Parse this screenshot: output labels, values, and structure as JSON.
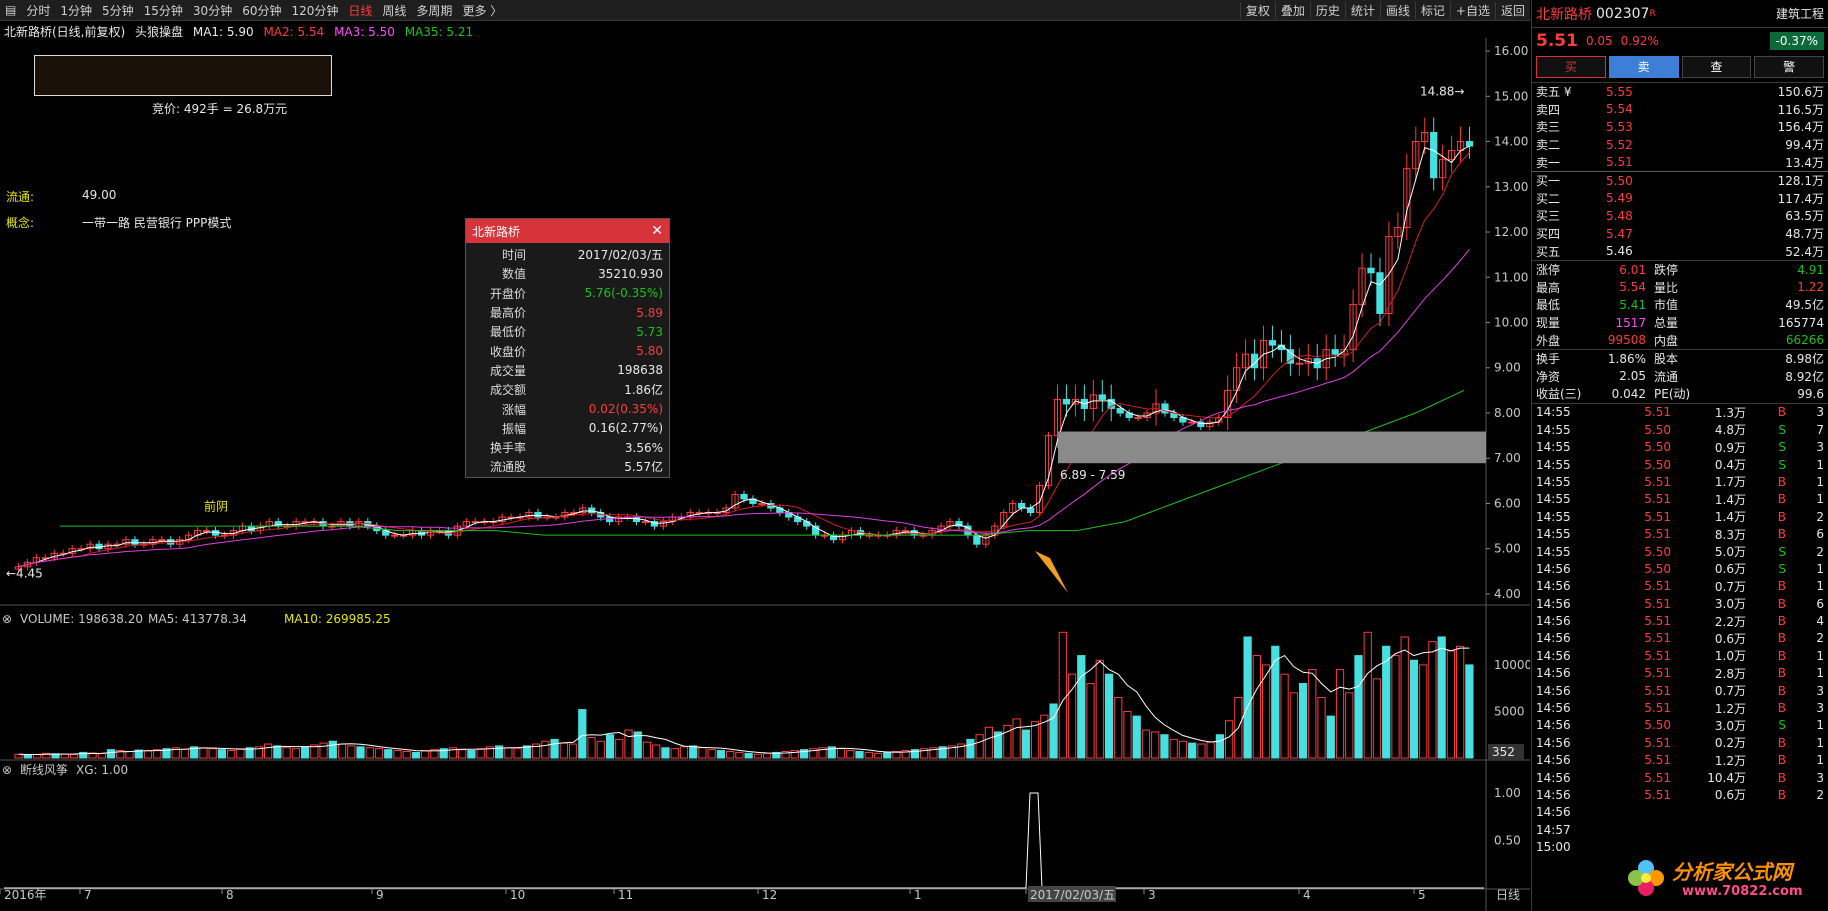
{
  "topbar": {
    "periods": [
      "分时",
      "1分钟",
      "5分钟",
      "15分钟",
      "30分钟",
      "60分钟",
      "120分钟",
      "日线",
      "周线",
      "多周期",
      "更多 〉"
    ],
    "active_index": 7,
    "tools": [
      "复权",
      "叠加",
      "历史",
      "统计",
      "画线",
      "标记",
      "+自选",
      "返回"
    ]
  },
  "legend": {
    "title": "北新路桥(日线,前复权)",
    "formula": "头狼操盘",
    "ma1": "MA1: 5.90",
    "ma2": "MA2: 5.54",
    "ma3": "MA3: 5.50",
    "ma35": "MA35: 5.21"
  },
  "overlay": {
    "auction": "竞价: 492手 = 26.8万元",
    "float_label": "流通:",
    "float_value": "49.00",
    "concept_label": "概念:",
    "concept_value": "一带一路 民营银行 PPP模式",
    "low_price": "←4.45",
    "high_price": "14.88→",
    "range_label": "6.89 - 7.59",
    "marker": "前阴"
  },
  "price_axis": [
    "16.00",
    "15.00",
    "14.00",
    "13.00",
    "12.00",
    "11.00",
    "10.00",
    "9.00",
    "8.00",
    "7.00",
    "6.00",
    "5.00",
    "4.00"
  ],
  "volume": {
    "label": "VOLUME: 198638.20",
    "ma5": "MA5: 413778.34",
    "ma10": "MA10: 269985.25",
    "axis": [
      "10000",
      "5000"
    ],
    "current": "352"
  },
  "indicator": {
    "label": "断线风筝",
    "xg": "XG: 1.00",
    "axis": [
      "1.00",
      "0.50"
    ]
  },
  "date_axis": [
    "2016年",
    "7",
    "8",
    "9",
    "10",
    "11",
    "12",
    "1",
    "2017/02/03/五",
    "3",
    "4",
    "5"
  ],
  "period_button": "日线",
  "tooltip": {
    "title": "北新路桥",
    "rows": [
      {
        "label": "时间",
        "value": "2017/02/03/五",
        "color": "#e8e8e8"
      },
      {
        "label": "数值",
        "value": "35210.930",
        "color": "#e8e8e8"
      },
      {
        "label": "开盘价",
        "value": "5.76(-0.35%)",
        "color": "#19c219"
      },
      {
        "label": "最高价",
        "value": "5.89",
        "color": "#ff3b3b"
      },
      {
        "label": "最低价",
        "value": "5.73",
        "color": "#19c219"
      },
      {
        "label": "收盘价",
        "value": "5.80",
        "color": "#ff3b3b"
      },
      {
        "label": "成交量",
        "value": "198638",
        "color": "#e8e8e8"
      },
      {
        "label": "成交额",
        "value": "1.86亿",
        "color": "#e8e8e8"
      },
      {
        "label": "涨幅",
        "value": "0.02(0.35%)",
        "color": "#ff3b3b"
      },
      {
        "label": "振幅",
        "value": "0.16(2.77%)",
        "color": "#e8e8e8"
      },
      {
        "label": "换手率",
        "value": "3.56%",
        "color": "#e8e8e8"
      },
      {
        "label": "流通股",
        "value": "5.57亿",
        "color": "#e8e8e8"
      }
    ]
  },
  "quote": {
    "name": "北新路桥",
    "code": "002307",
    "badge": "R",
    "sector": "建筑工程",
    "sector_change": "-0.37%",
    "price": "5.51",
    "change": "0.05",
    "change_pct": "0.92%",
    "buttons": [
      "买",
      "卖",
      "查",
      "警"
    ],
    "asks": [
      {
        "label": "卖五 ¥",
        "price": "5.55",
        "vol": "150.6万"
      },
      {
        "label": "卖四",
        "price": "5.54",
        "vol": "116.5万"
      },
      {
        "label": "卖三",
        "price": "5.53",
        "vol": "156.4万"
      },
      {
        "label": "卖二",
        "price": "5.52",
        "vol": "99.4万"
      },
      {
        "label": "卖一",
        "price": "5.51",
        "vol": "13.4万"
      }
    ],
    "bids": [
      {
        "label": "买一",
        "price": "5.50",
        "vol": "128.1万"
      },
      {
        "label": "买二",
        "price": "5.49",
        "vol": "117.4万"
      },
      {
        "label": "买三",
        "price": "5.48",
        "vol": "63.5万"
      },
      {
        "label": "买四",
        "price": "5.47",
        "vol": "48.7万"
      },
      {
        "label": "买五",
        "price": "5.46",
        "vol": "52.4万"
      }
    ],
    "stats": [
      {
        "l1": "涨停",
        "v1": "6.01",
        "c1": "#ff3b3b",
        "l2": "跌停",
        "v2": "4.91",
        "c2": "#19c219"
      },
      {
        "l1": "最高",
        "v1": "5.54",
        "c1": "#ff3b3b",
        "l2": "量比",
        "v2": "1.22",
        "c2": "#ff3b3b"
      },
      {
        "l1": "最低",
        "v1": "5.41",
        "c1": "#19c219",
        "l2": "市值",
        "v2": "49.5亿",
        "c2": "#e8e8e8"
      },
      {
        "l1": "现量",
        "v1": "1517",
        "c1": "#ff4dff",
        "l2": "总量",
        "v2": "165774",
        "c2": "#e8e8e8"
      },
      {
        "l1": "外盘",
        "v1": "99508",
        "c1": "#ff3b3b",
        "l2": "内盘",
        "v2": "66266",
        "c2": "#19c219"
      }
    ],
    "stats2": [
      {
        "l1": "换手",
        "v1": "1.86%",
        "l2": "股本",
        "v2": "8.98亿"
      },
      {
        "l1": "净资",
        "v1": "2.05",
        "l2": "流通",
        "v2": "8.92亿"
      },
      {
        "l1": "收益(三)",
        "v1": "0.042",
        "l2": "PE(动)",
        "v2": "99.6"
      }
    ],
    "ticks": [
      {
        "t": "14:55",
        "p": "5.51",
        "v": "1.3万",
        "bs": "B",
        "n": "3"
      },
      {
        "t": "14:55",
        "p": "5.50",
        "v": "4.8万",
        "bs": "S",
        "n": "7"
      },
      {
        "t": "14:55",
        "p": "5.50",
        "v": "0.9万",
        "bs": "S",
        "n": "3"
      },
      {
        "t": "14:55",
        "p": "5.50",
        "v": "0.4万",
        "bs": "S",
        "n": "1"
      },
      {
        "t": "14:55",
        "p": "5.51",
        "v": "1.7万",
        "bs": "B",
        "n": "1"
      },
      {
        "t": "14:55",
        "p": "5.51",
        "v": "1.4万",
        "bs": "B",
        "n": "1"
      },
      {
        "t": "14:55",
        "p": "5.51",
        "v": "1.4万",
        "bs": "B",
        "n": "2"
      },
      {
        "t": "14:55",
        "p": "5.51",
        "v": "8.3万",
        "bs": "B",
        "n": "6"
      },
      {
        "t": "14:55",
        "p": "5.50",
        "v": "5.0万",
        "bs": "S",
        "n": "2"
      },
      {
        "t": "14:56",
        "p": "5.50",
        "v": "0.6万",
        "bs": "S",
        "n": "1"
      },
      {
        "t": "14:56",
        "p": "5.51",
        "v": "0.7万",
        "bs": "B",
        "n": "1"
      },
      {
        "t": "14:56",
        "p": "5.51",
        "v": "3.0万",
        "bs": "B",
        "n": "6"
      },
      {
        "t": "14:56",
        "p": "5.51",
        "v": "2.2万",
        "bs": "B",
        "n": "4"
      },
      {
        "t": "14:56",
        "p": "5.51",
        "v": "0.6万",
        "bs": "B",
        "n": "2"
      },
      {
        "t": "14:56",
        "p": "5.51",
        "v": "1.0万",
        "bs": "B",
        "n": "1"
      },
      {
        "t": "14:56",
        "p": "5.51",
        "v": "2.8万",
        "bs": "B",
        "n": "1"
      },
      {
        "t": "14:56",
        "p": "5.51",
        "v": "0.7万",
        "bs": "B",
        "n": "3"
      },
      {
        "t": "14:56",
        "p": "5.51",
        "v": "1.2万",
        "bs": "B",
        "n": "3"
      },
      {
        "t": "14:56",
        "p": "5.50",
        "v": "3.0万",
        "bs": "S",
        "n": "1"
      },
      {
        "t": "14:56",
        "p": "5.51",
        "v": "0.2万",
        "bs": "B",
        "n": "1"
      },
      {
        "t": "14:56",
        "p": "5.51",
        "v": "1.2万",
        "bs": "B",
        "n": "1"
      },
      {
        "t": "14:56",
        "p": "5.51",
        "v": "10.4万",
        "bs": "B",
        "n": "3"
      },
      {
        "t": "14:56",
        "p": "5.51",
        "v": "0.6万",
        "bs": "B",
        "n": "2"
      },
      {
        "t": "14:56",
        "p": "",
        "v": "",
        "bs": "",
        "n": ""
      },
      {
        "t": "14:57",
        "p": "",
        "v": "",
        "bs": "",
        "n": ""
      },
      {
        "t": "15:00",
        "p": "",
        "v": "",
        "bs": "",
        "n": ""
      }
    ]
  },
  "watermark": {
    "text": "分析家公式网",
    "url": "www.70822.com"
  },
  "colors": {
    "up": "#ff3b3b",
    "down": "#46e0e0",
    "ma1": "#ffffff",
    "ma2": "#d02020",
    "ma3": "#e040e0",
    "ma35": "#20c020",
    "buy_btn": "#d6333a",
    "sell_btn": "#3d7fd6"
  },
  "chart_data": {
    "type": "candlestick",
    "price_range": [
      3.8,
      16.2
    ],
    "volume_range": [
      0,
      14500
    ],
    "closes": [
      4.6,
      4.7,
      4.8,
      4.8,
      4.9,
      4.9,
      5.0,
      5.0,
      5.1,
      5.0,
      5.1,
      5.1,
      5.2,
      5.1,
      5.1,
      5.2,
      5.2,
      5.1,
      5.2,
      5.3,
      5.4,
      5.4,
      5.3,
      5.3,
      5.4,
      5.5,
      5.4,
      5.5,
      5.6,
      5.5,
      5.5,
      5.6,
      5.6,
      5.6,
      5.5,
      5.5,
      5.6,
      5.5,
      5.6,
      5.5,
      5.4,
      5.3,
      5.3,
      5.3,
      5.4,
      5.3,
      5.4,
      5.4,
      5.3,
      5.5,
      5.6,
      5.6,
      5.6,
      5.6,
      5.7,
      5.7,
      5.7,
      5.8,
      5.7,
      5.7,
      5.7,
      5.8,
      5.8,
      5.9,
      5.8,
      5.7,
      5.6,
      5.7,
      5.7,
      5.6,
      5.6,
      5.5,
      5.6,
      5.7,
      5.7,
      5.8,
      5.8,
      5.8,
      5.8,
      5.9,
      6.2,
      6.1,
      6.0,
      6.0,
      5.9,
      5.8,
      5.7,
      5.6,
      5.5,
      5.3,
      5.3,
      5.2,
      5.3,
      5.4,
      5.3,
      5.3,
      5.3,
      5.3,
      5.4,
      5.4,
      5.3,
      5.3,
      5.4,
      5.5,
      5.6,
      5.5,
      5.3,
      5.1,
      5.3,
      5.5,
      5.8,
      6.0,
      5.9,
      5.8,
      6.4,
      7.5,
      8.3,
      8.2,
      8.3,
      8.1,
      8.4,
      8.3,
      8.1,
      8.0,
      7.9,
      7.9,
      8.0,
      8.2,
      8.0,
      7.9,
      7.8,
      7.8,
      7.7,
      7.8,
      7.9,
      8.5,
      9.0,
      9.3,
      9.0,
      9.6,
      9.5,
      9.4,
      9.1,
      9.1,
      9.2,
      9.0,
      9.4,
      9.3,
      9.4,
      10.4,
      11.2,
      11.1,
      10.2,
      11.9,
      12.1,
      13.4,
      14.0,
      14.2,
      13.2,
      13.6,
      13.8,
      14.0,
      13.9
    ],
    "ma35": [
      5.5,
      5.5,
      5.5,
      5.5,
      5.5,
      5.5,
      5.5,
      5.4,
      5.4,
      5.4,
      5.3,
      5.3,
      5.3,
      5.3,
      5.3,
      5.3,
      5.3,
      5.3,
      5.3,
      5.3,
      5.4,
      5.4,
      5.6,
      6.0,
      6.4,
      6.8,
      7.2,
      7.6,
      8.0,
      8.5
    ],
    "volumes": [
      400,
      350,
      380,
      500,
      450,
      420,
      380,
      600,
      550,
      500,
      900,
      800,
      700,
      850,
      750,
      900,
      1000,
      1100,
      950,
      1200,
      1100,
      1000,
      900,
      800,
      1000,
      1100,
      1200,
      1500,
      1300,
      1100,
      1000,
      1200,
      1400,
      1600,
      1800,
      1500,
      1300,
      1200,
      1100,
      1000,
      900,
      800,
      700,
      600,
      800,
      900,
      1000,
      1100,
      900,
      800,
      1000,
      1200,
      1300,
      1100,
      1000,
      1300,
      1500,
      1800,
      2000,
      1600,
      1500,
      5200,
      2200,
      1800,
      2500,
      2000,
      3000,
      2800,
      1700,
      1400,
      1100,
      1000,
      1200,
      1300,
      1100,
      900,
      800,
      700,
      600,
      500,
      400,
      500,
      600,
      700,
      800,
      900,
      1000,
      1100,
      1200,
      1000,
      800,
      700,
      600,
      500,
      600,
      700,
      800,
      900,
      1000,
      1100,
      1200,
      1300,
      1500,
      2000,
      2500,
      3300,
      2800,
      3500,
      4200,
      3000,
      3900,
      4600,
      5800,
      13500,
      9000,
      11000,
      8000,
      10500,
      9000,
      6500,
      5000,
      4500,
      3000,
      2800,
      2500,
      2000,
      1800,
      1600,
      1500,
      1700,
      2500,
      4000,
      6500,
      13000,
      11000,
      10000,
      12000,
      9000,
      7000,
      8000,
      9500,
      6500,
      4500,
      9500,
      7000,
      11000,
      13500,
      8500,
      12000,
      11000,
      13000,
      10500,
      10000,
      12500,
      13000,
      11500,
      12000,
      10000
    ]
  }
}
